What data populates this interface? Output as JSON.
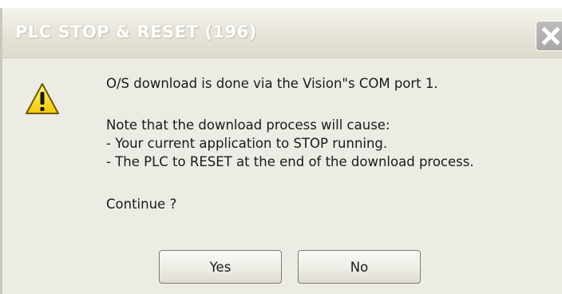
{
  "dialog": {
    "title": "PLC STOP & RESET (196)",
    "message_line1": "O/S download is done via the Vision\"s COM port 1.",
    "note_line1": "Note that the download process will cause:",
    "note_line2": "- Your current application to STOP running.",
    "note_line3": "- The PLC to RESET at the end of the download process.",
    "prompt": "Continue ?",
    "icon": "warning-icon",
    "close_icon": "close-icon"
  },
  "buttons": {
    "yes_label": "Yes",
    "no_label": "No"
  }
}
